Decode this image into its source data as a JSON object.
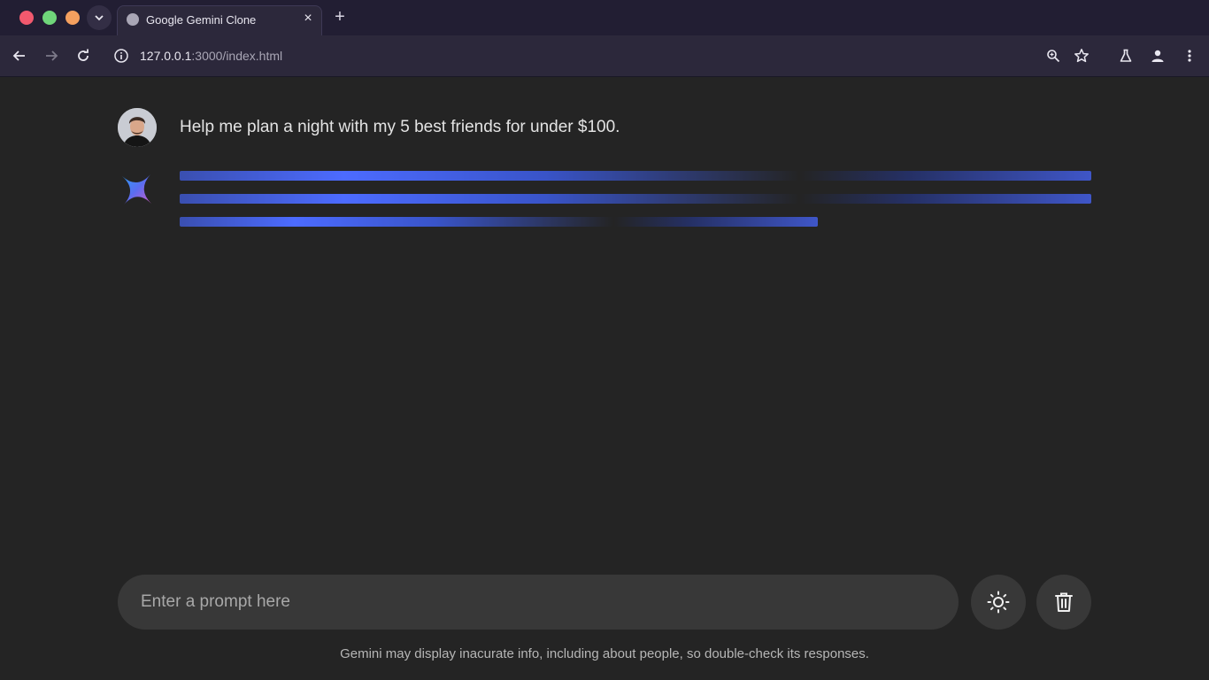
{
  "browser": {
    "tab": {
      "title": "Google Gemini Clone",
      "close_label": "×"
    },
    "new_tab_label": "+",
    "url": {
      "host": "127.0.0.1",
      "path": ":3000/index.html"
    },
    "window_controls": [
      "close",
      "minimize",
      "maximize"
    ]
  },
  "chat": {
    "user_message": "Help me plan a night with my 5 best friends for under $100.",
    "response_state": "loading"
  },
  "prompt": {
    "placeholder": "Enter a prompt here",
    "value": ""
  },
  "buttons": {
    "theme": "sun-icon",
    "delete": "trash-icon"
  },
  "disclaimer": "Gemini may display inacurate info, including about people, so double-check its responses.",
  "colors": {
    "page_bg": "#242424",
    "chrome_bg": "#2c283b",
    "accent_blue": "#4c6bff"
  }
}
